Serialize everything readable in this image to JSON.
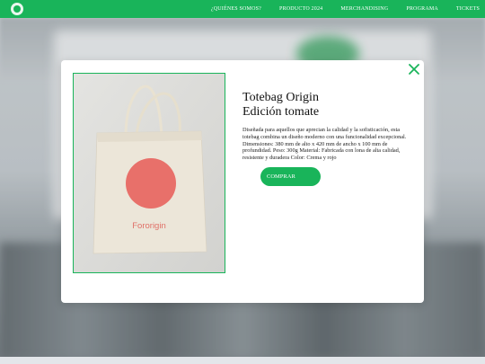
{
  "nav": {
    "items": [
      "¿QUIÉNES SOMOS?",
      "PRODUCTO 2024",
      "MERCHANDISING",
      "PROGRAMA",
      "TICKETS"
    ]
  },
  "product": {
    "title_line1": "Totebag Origin",
    "title_line2": "Edición tomate",
    "description": "Diseñada para aquellos que aprecian la calidad y la sofisticación, esta totebag combina un diseño moderno con una funcionalidad excepcional. Dimensiones: 380 mm de alto x 420 mm de ancho x 100 mm de profundidad. Peso: 300g Material: Fabricada con lona de alta calidad, resistente y duradera Color: Crema y rojo",
    "bag_print": "Fororigin",
    "buy_label": "COMPRAR"
  },
  "colors": {
    "brand_green": "#19b45a",
    "tomato": "#e8706a",
    "bag_cream": "#ece6d9"
  },
  "icons": [
    "logo-icon",
    "close-icon"
  ]
}
